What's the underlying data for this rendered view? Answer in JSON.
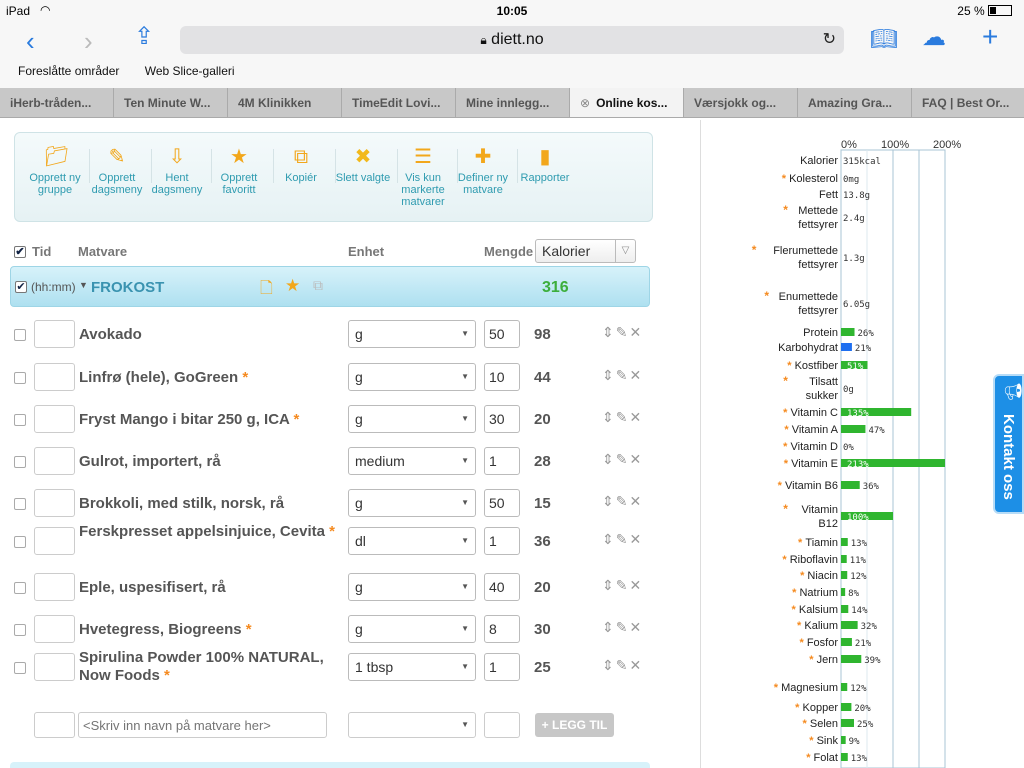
{
  "status": {
    "device": "iPad",
    "time": "10:05",
    "battery": "25 %"
  },
  "browser": {
    "url": "diett.no",
    "bookmarks": [
      "Foreslåtte områder",
      "Web Slice-galleri"
    ],
    "tabs": [
      "iHerb-tråden...",
      "Ten Minute W...",
      "4M Klinikken",
      "TimeEdit Lovi...",
      "Mine innlegg...",
      "Online kos...",
      "Værsjokk og...",
      "Amazing Gra...",
      "FAQ | Best Or..."
    ],
    "active_tab": 5
  },
  "toolbar": [
    {
      "label": "Opprett ny gruppe",
      "icon": "folder-add-icon"
    },
    {
      "label": "Opprett dagsmeny",
      "icon": "edit-menu-icon"
    },
    {
      "label": "Hent dagsmeny",
      "icon": "fetch-menu-icon"
    },
    {
      "label": "Opprett favoritt",
      "icon": "star-add-icon"
    },
    {
      "label": "Kopiér",
      "icon": "copy-icon"
    },
    {
      "label": "Slett valgte",
      "icon": "delete-icon"
    },
    {
      "label": "Vis kun markerte matvarer",
      "icon": "list-icon"
    },
    {
      "label": "Definer ny matvare",
      "icon": "define-food-icon"
    },
    {
      "label": "Rapporter",
      "icon": "bar-chart-icon"
    }
  ],
  "table": {
    "col_tid": "Tid",
    "col_matvare": "Matvare",
    "col_enhet": "Enhet",
    "col_mengde": "Mengde",
    "kalori_select": "Kalorier"
  },
  "meal": {
    "time": "(hh:mm)",
    "name": "FROKOST",
    "total": "316"
  },
  "items": [
    {
      "name": "Avokado",
      "star": false,
      "unit": "g",
      "qty": "50",
      "kal": "98"
    },
    {
      "name": "Linfrø (hele), GoGreen",
      "star": true,
      "unit": "g",
      "qty": "10",
      "kal": "44"
    },
    {
      "name": "Fryst Mango i bitar 250 g, ICA",
      "star": true,
      "unit": "g",
      "qty": "30",
      "kal": "20"
    },
    {
      "name": "Gulrot, importert, rå",
      "star": false,
      "unit": "medium",
      "qty": "1",
      "kal": "28"
    },
    {
      "name": "Brokkoli, med stilk, norsk, rå",
      "star": false,
      "unit": "g",
      "qty": "50",
      "kal": "15"
    },
    {
      "name": "Ferskpresset appelsinjuice, Cevita",
      "star": true,
      "unit": "dl",
      "qty": "1",
      "kal": "36"
    },
    {
      "name": "Eple, uspesifisert, rå",
      "star": false,
      "unit": "g",
      "qty": "40",
      "kal": "20"
    },
    {
      "name": "Hvetegress, Biogreens",
      "star": true,
      "unit": "g",
      "qty": "8",
      "kal": "30"
    },
    {
      "name": "Spirulina Powder 100% NATURAL, Now Foods",
      "star": true,
      "unit": "1 tbsp",
      "qty": "1",
      "kal": "25"
    }
  ],
  "add_row": {
    "placeholder": "<Skriv inn navn på matvare her>",
    "button": "+ LEGG TIL"
  },
  "kontakt": "Kontakt oss",
  "chart_data": {
    "type": "bar",
    "orientation": "horizontal",
    "axis_ticks": [
      "0%",
      "100%",
      "200%"
    ],
    "xlim": [
      0,
      200
    ],
    "rows": [
      {
        "label": "Kalorier",
        "star": false,
        "value": 0,
        "text": "315kcal"
      },
      {
        "label": "Kolesterol",
        "star": true,
        "value": 0,
        "text": "0mg"
      },
      {
        "label": "Fett",
        "star": false,
        "value": 0,
        "text": "13.8g"
      },
      {
        "label": "Mettede fettsyrer",
        "star": true,
        "value": 0,
        "text": "2.4g"
      },
      {
        "label": "Flerumettede fettsyrer",
        "star": true,
        "value": 0,
        "text": "1.3g"
      },
      {
        "label": "Enumettede fettsyrer",
        "star": true,
        "value": 0,
        "text": "6.05g"
      },
      {
        "label": "Protein",
        "star": false,
        "value": 26,
        "text": "26%"
      },
      {
        "label": "Karbohydrat",
        "star": false,
        "value": 21,
        "text": "21%",
        "color": "#1e6ff0"
      },
      {
        "label": "Kostfiber",
        "star": true,
        "value": 51,
        "text": "51%"
      },
      {
        "label": "Tilsatt sukker",
        "star": true,
        "value": 0,
        "text": "0g"
      },
      {
        "label": "Vitamin C",
        "star": true,
        "value": 135,
        "text": "135%"
      },
      {
        "label": "Vitamin A",
        "star": true,
        "value": 47,
        "text": "47%"
      },
      {
        "label": "Vitamin D",
        "star": true,
        "value": 0,
        "text": "0%"
      },
      {
        "label": "Vitamin E",
        "star": true,
        "value": 213,
        "text": "213%"
      },
      {
        "label": "Vitamin B6",
        "star": true,
        "value": 36,
        "text": "36%"
      },
      {
        "label": "Vitamin B12",
        "star": true,
        "value": 100,
        "text": "100%"
      },
      {
        "label": "Tiamin",
        "star": true,
        "value": 13,
        "text": "13%"
      },
      {
        "label": "Riboflavin",
        "star": true,
        "value": 11,
        "text": "11%"
      },
      {
        "label": "Niacin",
        "star": true,
        "value": 12,
        "text": "12%"
      },
      {
        "label": "Natrium",
        "star": true,
        "value": 8,
        "text": "8%"
      },
      {
        "label": "Kalsium",
        "star": true,
        "value": 14,
        "text": "14%"
      },
      {
        "label": "Kalium",
        "star": true,
        "value": 32,
        "text": "32%"
      },
      {
        "label": "Fosfor",
        "star": true,
        "value": 21,
        "text": "21%"
      },
      {
        "label": "Jern",
        "star": true,
        "value": 39,
        "text": "39%"
      },
      {
        "label": "Magnesium",
        "star": true,
        "value": 12,
        "text": "12%"
      },
      {
        "label": "Kopper",
        "star": true,
        "value": 20,
        "text": "20%"
      },
      {
        "label": "Selen",
        "star": true,
        "value": 25,
        "text": "25%"
      },
      {
        "label": "Sink",
        "star": true,
        "value": 9,
        "text": "9%"
      },
      {
        "label": "Folat",
        "star": true,
        "value": 13,
        "text": "13%"
      }
    ],
    "colors": {
      "bar": "#2fb52f",
      "accent_star": "#f58a1f",
      "grid": "#a9c4d6"
    }
  }
}
